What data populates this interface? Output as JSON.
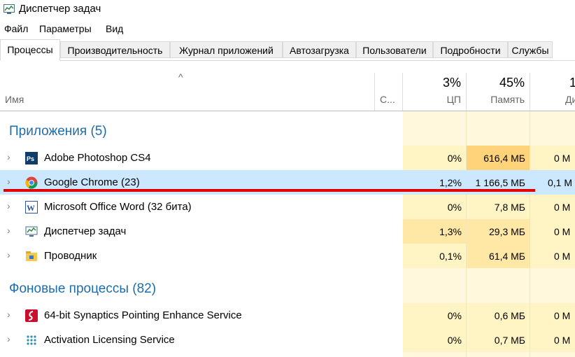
{
  "window": {
    "title": "Диспетчер задач",
    "icon": "task-manager-icon"
  },
  "menu": [
    "Файл",
    "Параметры",
    "Вид"
  ],
  "tabs": [
    "Процессы",
    "Производительность",
    "Журнал приложений",
    "Автозагрузка",
    "Пользователи",
    "Подробности",
    "Службы"
  ],
  "active_tab": "Процессы",
  "columns": {
    "sort_indicator": "^",
    "name": "Имя",
    "status": "С...",
    "cpu": {
      "pct": "3%",
      "label": "ЦП"
    },
    "memory": {
      "pct": "45%",
      "label": "Память"
    },
    "disk": {
      "pct": "1",
      "label": "Ди"
    }
  },
  "groups": [
    {
      "title": "Приложения (5)",
      "rows": [
        {
          "name": "Adobe Photoshop CS4",
          "icon": "photoshop-icon",
          "cpu": "0%",
          "memory": "616,4 МБ",
          "disk": "0 М"
        },
        {
          "name": "Google Chrome (23)",
          "icon": "chrome-icon",
          "cpu": "1,2%",
          "memory": "1 166,5 МБ",
          "disk": "0,1 М",
          "selected": true
        },
        {
          "name": "Microsoft Office Word (32 бита)",
          "icon": "word-icon",
          "cpu": "0%",
          "memory": "7,8 МБ",
          "disk": "0 М"
        },
        {
          "name": "Диспетчер задач",
          "icon": "task-manager-icon",
          "cpu": "1,3%",
          "memory": "29,3 МБ",
          "disk": "0 М"
        },
        {
          "name": "Проводник",
          "icon": "explorer-folder-icon",
          "cpu": "0,1%",
          "memory": "61,4 МБ",
          "disk": "0 М"
        }
      ]
    },
    {
      "title": "Фоновые процессы (82)",
      "rows": [
        {
          "name": "64-bit Synaptics Pointing Enhance Service",
          "icon": "synaptics-icon",
          "cpu": "0%",
          "memory": "0,6 МБ",
          "disk": "0 М"
        },
        {
          "name": "Activation Licensing Service",
          "icon": "licensing-service-icon",
          "cpu": "0%",
          "memory": "0,7 МБ",
          "disk": "0 М"
        }
      ]
    }
  ],
  "colors": {
    "group_title": "#1d6dad",
    "selected_row": "#cce8ff",
    "cpu_fill": "#fff4c4",
    "memory_fill": "#ffe8a6",
    "memory_fill_high": "#ffd37a",
    "annotation_line": "#e00000"
  }
}
